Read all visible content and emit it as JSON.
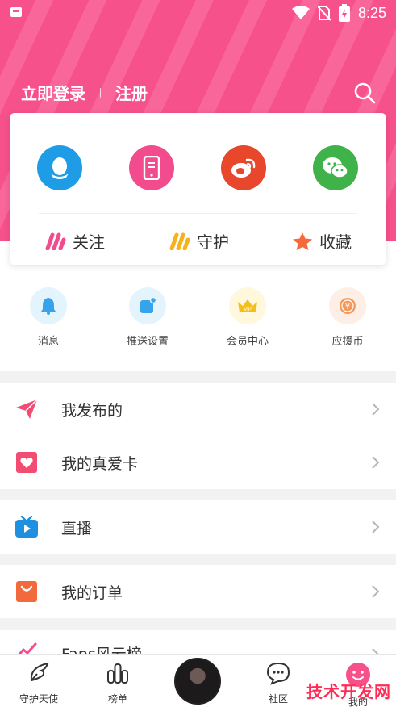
{
  "status_bar": {
    "time": "8:25"
  },
  "header": {
    "login_label": "立即登录",
    "register_label": "注册"
  },
  "card": {
    "social": [
      "qq-icon",
      "phone-icon",
      "weibo-icon",
      "wechat-icon"
    ],
    "tabs": [
      {
        "label": "关注",
        "icon": "follow-icon"
      },
      {
        "label": "守护",
        "icon": "guard-icon"
      },
      {
        "label": "收藏",
        "icon": "star-icon"
      }
    ]
  },
  "quick_actions": [
    {
      "label": "消息",
      "icon": "bell-icon"
    },
    {
      "label": "推送设置",
      "icon": "push-icon"
    },
    {
      "label": "会员中心",
      "icon": "vip-crown-icon",
      "badge": "VIP"
    },
    {
      "label": "应援币",
      "icon": "coin-icon",
      "symbol": "¥"
    }
  ],
  "menu": [
    {
      "label": "我发布的",
      "icon": "send-icon"
    },
    {
      "label": "我的真爱卡",
      "icon": "heart-card-icon"
    },
    {
      "label": "直播",
      "icon": "live-tv-icon"
    },
    {
      "label": "我的订单",
      "icon": "shopping-bag-icon"
    },
    {
      "label": "Fans风云榜",
      "icon": "trend-icon"
    }
  ],
  "tabbar": [
    {
      "label": "守护天使",
      "icon": "angel-wing-icon"
    },
    {
      "label": "榜单",
      "icon": "bar-chart-icon"
    },
    {
      "label": "",
      "icon": "avatar"
    },
    {
      "label": "社区",
      "icon": "chat-bubble-icon"
    },
    {
      "label": "我的",
      "icon": "face-icon"
    }
  ],
  "watermark": "技术开发网",
  "colors": {
    "brand_pink": "#f7518c",
    "qq_blue": "#1f9ce6",
    "weibo_red": "#e8472b",
    "wechat_green": "#3fb34a"
  }
}
